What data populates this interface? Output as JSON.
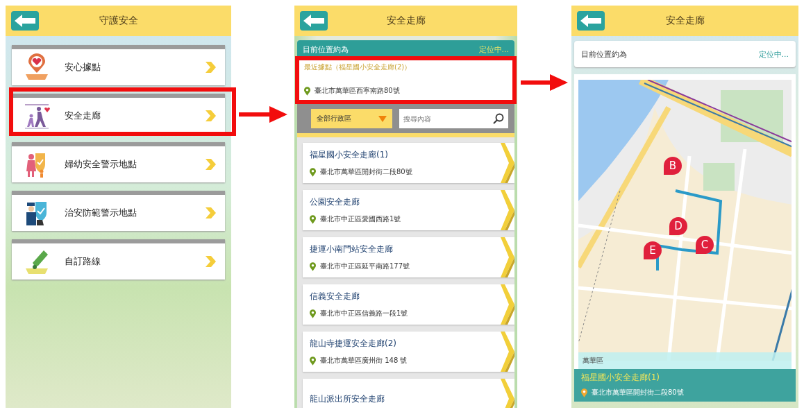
{
  "menu_screen": {
    "title": "守護安全",
    "items": [
      {
        "label": "安心據點",
        "kind": "pin",
        "highlighted": false
      },
      {
        "label": "安全走廊",
        "kind": "walk",
        "highlighted": true
      },
      {
        "label": "婦幼安全警示地點",
        "kind": "family",
        "highlighted": false
      },
      {
        "label": "治安防範警示地點",
        "kind": "police",
        "highlighted": false
      },
      {
        "label": "自訂路線",
        "kind": "route",
        "highlighted": false
      }
    ]
  },
  "list_screen": {
    "title": "安全走廊",
    "location_label": "目前位置約為",
    "location_status": "定位中...",
    "nearest": {
      "title": "最近據點（福星國小安全走廊(2)）",
      "address": "臺北市萬華區西寧南路80號",
      "highlighted": true
    },
    "district_select": "全部行政區",
    "search": {
      "placeholder": "搜尋內容"
    },
    "items": [
      {
        "name": "福星國小安全走廊(1)",
        "address": "臺北市萬華區開封街二段80號"
      },
      {
        "name": "公園安全走廊",
        "address": "臺北市中正區愛國西路1號"
      },
      {
        "name": "捷運小南門站安全走廊",
        "address": "臺北市中正區延平南路177號"
      },
      {
        "name": "信義安全走廊",
        "address": "臺北市中正區信義路一段1號"
      },
      {
        "name": "龍山寺捷運安全走廊(2)",
        "address": "臺北市萬華區廣州街 148 號"
      },
      {
        "name": "龍山派出所安全走廊"
      }
    ]
  },
  "map_screen": {
    "title": "安全走廊",
    "location_label": "目前位置約為",
    "location_status": "定位中...",
    "markers": [
      {
        "label": "B"
      },
      {
        "label": "D"
      },
      {
        "label": "C"
      },
      {
        "label": "E"
      }
    ],
    "district": "萬華區",
    "selected": {
      "name": "福星國小安全走廊(1)",
      "address": "臺北市萬華區開封街二段80號"
    }
  }
}
